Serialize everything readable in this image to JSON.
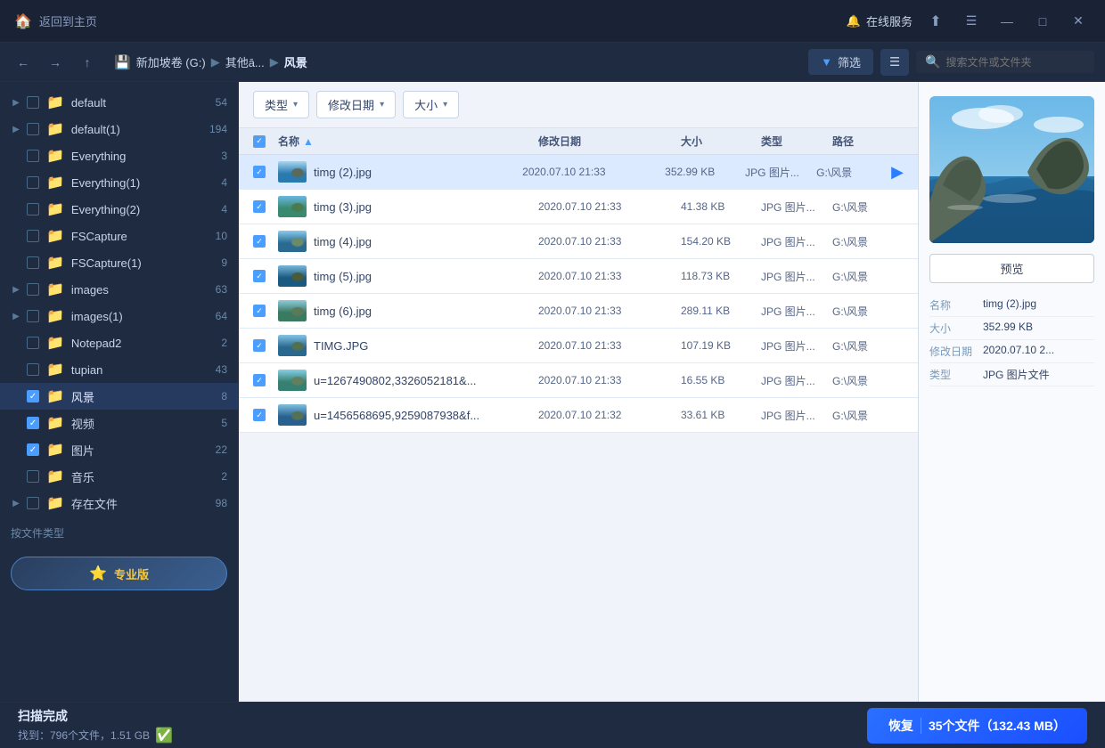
{
  "titlebar": {
    "home_label": "返回到主页",
    "online_service": "在线服务",
    "menu_icon": "☰",
    "minimize": "—",
    "maximize": "□",
    "close": "✕"
  },
  "navbar": {
    "back_btn": "←",
    "forward_btn": "→",
    "up_btn": "↑",
    "drive": "新加坡卷 (G:)",
    "sep1": "▶",
    "folder1": "其他ā...",
    "sep2": "▶",
    "folder2": "风景",
    "filter_label": "筛选",
    "search_placeholder": "搜索文件或文件夹"
  },
  "toolbar": {
    "type_btn": "类型",
    "date_btn": "修改日期",
    "size_btn": "大小"
  },
  "table": {
    "headers": {
      "name": "名称",
      "date": "修改日期",
      "size": "大小",
      "type": "类型",
      "path": "路径"
    },
    "rows": [
      {
        "checked": true,
        "name": "timg (2).jpg",
        "date": "2020.07.10 21:33",
        "size": "352.99 KB",
        "type": "JPG 图片...",
        "path": "G:\\风景",
        "selected": true
      },
      {
        "checked": true,
        "name": "timg (3).jpg",
        "date": "2020.07.10 21:33",
        "size": "41.38 KB",
        "type": "JPG 图片...",
        "path": "G:\\风景",
        "selected": false
      },
      {
        "checked": true,
        "name": "timg (4).jpg",
        "date": "2020.07.10 21:33",
        "size": "154.20 KB",
        "type": "JPG 图片...",
        "path": "G:\\风景",
        "selected": false
      },
      {
        "checked": true,
        "name": "timg (5).jpg",
        "date": "2020.07.10 21:33",
        "size": "118.73 KB",
        "type": "JPG 图片...",
        "path": "G:\\风景",
        "selected": false
      },
      {
        "checked": true,
        "name": "timg (6).jpg",
        "date": "2020.07.10 21:33",
        "size": "289.11 KB",
        "type": "JPG 图片...",
        "path": "G:\\风景",
        "selected": false
      },
      {
        "checked": true,
        "name": "TIMG.JPG",
        "date": "2020.07.10 21:33",
        "size": "107.19 KB",
        "type": "JPG 图片...",
        "path": "G:\\风景",
        "selected": false
      },
      {
        "checked": true,
        "name": "u=1267490802,3326052181&...",
        "date": "2020.07.10 21:33",
        "size": "16.55 KB",
        "type": "JPG 图片...",
        "path": "G:\\风景",
        "selected": false
      },
      {
        "checked": true,
        "name": "u=1456568695,9259087938&f...",
        "date": "2020.07.10 21:32",
        "size": "33.61 KB",
        "type": "JPG 图片...",
        "path": "G:\\风景",
        "selected": false
      }
    ]
  },
  "right_panel": {
    "preview_btn": "预览",
    "meta": {
      "name_key": "名称",
      "name_val": "timg (2).jpg",
      "size_key": "大小",
      "size_val": "352.99 KB",
      "date_key": "修改日期",
      "date_val": "2020.07.10 2...",
      "type_key": "类型",
      "type_val": "JPG 图片文件"
    }
  },
  "sidebar": {
    "items": [
      {
        "expand": "▶",
        "checked": false,
        "name": "default",
        "count": "54",
        "active": false
      },
      {
        "expand": "▶",
        "checked": false,
        "name": "default(1)",
        "count": "194",
        "active": false
      },
      {
        "expand": "",
        "checked": false,
        "name": "Everything",
        "count": "3",
        "active": false
      },
      {
        "expand": "",
        "checked": false,
        "name": "Everything(1)",
        "count": "4",
        "active": false
      },
      {
        "expand": "",
        "checked": false,
        "name": "Everything(2)",
        "count": "4",
        "active": false
      },
      {
        "expand": "",
        "checked": false,
        "name": "FSCapture",
        "count": "10",
        "active": false
      },
      {
        "expand": "",
        "checked": false,
        "name": "FSCapture(1)",
        "count": "9",
        "active": false
      },
      {
        "expand": "▶",
        "checked": false,
        "name": "images",
        "count": "63",
        "active": false
      },
      {
        "expand": "▶",
        "checked": false,
        "name": "images(1)",
        "count": "64",
        "active": false
      },
      {
        "expand": "",
        "checked": false,
        "name": "Notepad2",
        "count": "2",
        "active": false
      },
      {
        "expand": "",
        "checked": false,
        "name": "tupian",
        "count": "43",
        "active": false
      },
      {
        "expand": "",
        "checked": true,
        "name": "风景",
        "count": "8",
        "active": true
      },
      {
        "expand": "",
        "checked": true,
        "name": "视频",
        "count": "5",
        "active": false
      },
      {
        "expand": "",
        "checked": true,
        "name": "图片",
        "count": "22",
        "active": false
      },
      {
        "expand": "",
        "checked": false,
        "name": "音乐",
        "count": "2",
        "active": false
      },
      {
        "expand": "▶",
        "checked": false,
        "name": "存在文件",
        "count": "98",
        "active": false
      }
    ],
    "footer": "按文件类型",
    "pro_btn": "专业版"
  },
  "statusbar": {
    "title": "扫描完成",
    "sub": "找到：796个文件，1.51 GB",
    "recover_btn": "恢复",
    "recover_detail": "35个文件（132.43 MB）"
  },
  "colors": {
    "accent": "#4a9eff",
    "folder": "#f5a623",
    "checked": "#4a9eff",
    "ok_green": "#4ade80"
  }
}
